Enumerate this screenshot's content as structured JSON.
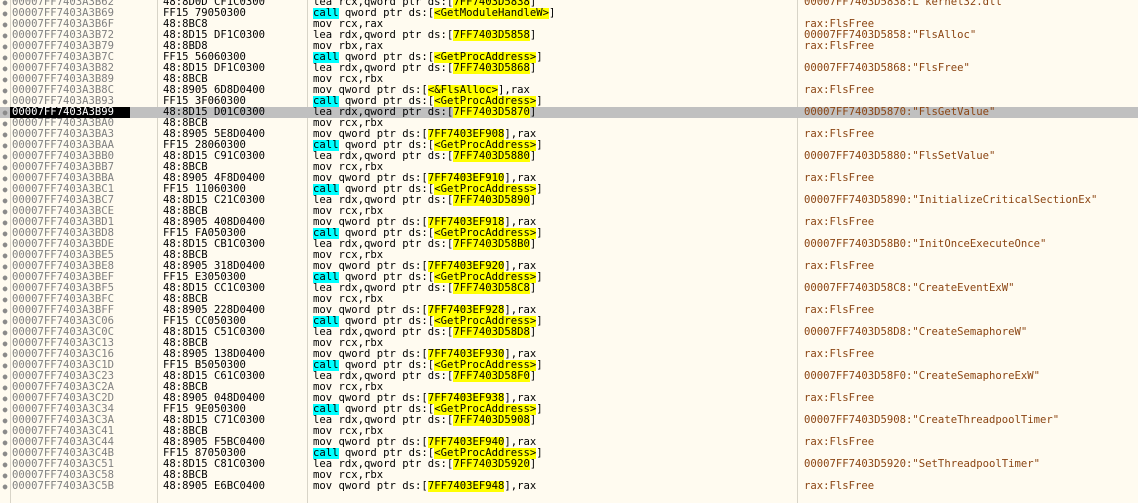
{
  "view": {
    "selected_address": "00007FF7403A3B99"
  },
  "rows": [
    {
      "addr": "00007FF7403A3B62",
      "bytes": "48:8D0D CF1C0300",
      "parts": [
        {
          "t": "mn",
          "v": "lea rcx,qword ptr ds:["
        },
        {
          "t": "mem",
          "v": "7FF7403D5838"
        },
        {
          "t": "mn",
          "v": "]"
        }
      ],
      "comment": "00007FF7403D5838:L\"kernel32.dll\""
    },
    {
      "addr": "00007FF7403A3B69",
      "bytes": "FF15 79050300",
      "parts": [
        {
          "t": "call",
          "v": "call"
        },
        {
          "t": "mn",
          "v": " qword ptr ds:["
        },
        {
          "t": "mem",
          "v": "<GetModuleHandleW>"
        },
        {
          "t": "mn",
          "v": "]"
        }
      ],
      "comment": ""
    },
    {
      "addr": "00007FF7403A3B6F",
      "bytes": "48:8BC8",
      "parts": [
        {
          "t": "mn",
          "v": "mov rcx,rax"
        }
      ],
      "comment": "rax:FlsFree"
    },
    {
      "addr": "00007FF7403A3B72",
      "bytes": "48:8D15 DF1C0300",
      "parts": [
        {
          "t": "mn",
          "v": "lea rdx,qword ptr ds:["
        },
        {
          "t": "mem",
          "v": "7FF7403D5858"
        },
        {
          "t": "mn",
          "v": "]"
        }
      ],
      "comment": "00007FF7403D5858:\"FlsAlloc\""
    },
    {
      "addr": "00007FF7403A3B79",
      "bytes": "48:8BD8",
      "parts": [
        {
          "t": "mn",
          "v": "mov rbx,rax"
        }
      ],
      "comment": "rax:FlsFree"
    },
    {
      "addr": "00007FF7403A3B7C",
      "bytes": "FF15 56060300",
      "parts": [
        {
          "t": "call",
          "v": "call"
        },
        {
          "t": "mn",
          "v": " qword ptr ds:["
        },
        {
          "t": "mem",
          "v": "<GetProcAddress>"
        },
        {
          "t": "mn",
          "v": "]"
        }
      ],
      "comment": ""
    },
    {
      "addr": "00007FF7403A3B82",
      "bytes": "48:8D15 DF1C0300",
      "parts": [
        {
          "t": "mn",
          "v": "lea rdx,qword ptr ds:["
        },
        {
          "t": "mem",
          "v": "7FF7403D5868"
        },
        {
          "t": "mn",
          "v": "]"
        }
      ],
      "comment": "00007FF7403D5868:\"FlsFree\""
    },
    {
      "addr": "00007FF7403A3B89",
      "bytes": "48:8BCB",
      "parts": [
        {
          "t": "mn",
          "v": "mov rcx,rbx"
        }
      ],
      "comment": ""
    },
    {
      "addr": "00007FF7403A3B8C",
      "bytes": "48:8905 6D8D0400",
      "parts": [
        {
          "t": "mn",
          "v": "mov qword ptr ds:["
        },
        {
          "t": "mem",
          "v": "<&FlsAlloc>"
        },
        {
          "t": "mn",
          "v": "],rax"
        }
      ],
      "comment": "rax:FlsFree"
    },
    {
      "addr": "00007FF7403A3B93",
      "bytes": "FF15 3F060300",
      "parts": [
        {
          "t": "call",
          "v": "call"
        },
        {
          "t": "mn",
          "v": " qword ptr ds:["
        },
        {
          "t": "mem",
          "v": "<GetProcAddress>"
        },
        {
          "t": "mn",
          "v": "]"
        }
      ],
      "comment": ""
    },
    {
      "addr": "00007FF7403A3B99",
      "bytes": "48:8D15 D01C0300",
      "parts": [
        {
          "t": "mn",
          "v": "lea rdx,qword ptr ds:["
        },
        {
          "t": "mem",
          "v": "7FF7403D5870"
        },
        {
          "t": "mn",
          "v": "]"
        }
      ],
      "comment": "00007FF7403D5870:\"FlsGetValue\""
    },
    {
      "addr": "00007FF7403A3BA0",
      "bytes": "48:8BCB",
      "parts": [
        {
          "t": "mn",
          "v": "mov rcx,rbx"
        }
      ],
      "comment": ""
    },
    {
      "addr": "00007FF7403A3BA3",
      "bytes": "48:8905 5E8D0400",
      "parts": [
        {
          "t": "mn",
          "v": "mov qword ptr ds:["
        },
        {
          "t": "mem",
          "v": "7FF7403EF908"
        },
        {
          "t": "mn",
          "v": "],rax"
        }
      ],
      "comment": "rax:FlsFree"
    },
    {
      "addr": "00007FF7403A3BAA",
      "bytes": "FF15 28060300",
      "parts": [
        {
          "t": "call",
          "v": "call"
        },
        {
          "t": "mn",
          "v": " qword ptr ds:["
        },
        {
          "t": "mem",
          "v": "<GetProcAddress>"
        },
        {
          "t": "mn",
          "v": "]"
        }
      ],
      "comment": ""
    },
    {
      "addr": "00007FF7403A3BB0",
      "bytes": "48:8D15 C91C0300",
      "parts": [
        {
          "t": "mn",
          "v": "lea rdx,qword ptr ds:["
        },
        {
          "t": "mem",
          "v": "7FF7403D5880"
        },
        {
          "t": "mn",
          "v": "]"
        }
      ],
      "comment": "00007FF7403D5880:\"FlsSetValue\""
    },
    {
      "addr": "00007FF7403A3BB7",
      "bytes": "48:8BCB",
      "parts": [
        {
          "t": "mn",
          "v": "mov rcx,rbx"
        }
      ],
      "comment": ""
    },
    {
      "addr": "00007FF7403A3BBA",
      "bytes": "48:8905 4F8D0400",
      "parts": [
        {
          "t": "mn",
          "v": "mov qword ptr ds:["
        },
        {
          "t": "mem",
          "v": "7FF7403EF910"
        },
        {
          "t": "mn",
          "v": "],rax"
        }
      ],
      "comment": "rax:FlsFree"
    },
    {
      "addr": "00007FF7403A3BC1",
      "bytes": "FF15 11060300",
      "parts": [
        {
          "t": "call",
          "v": "call"
        },
        {
          "t": "mn",
          "v": " qword ptr ds:["
        },
        {
          "t": "mem",
          "v": "<GetProcAddress>"
        },
        {
          "t": "mn",
          "v": "]"
        }
      ],
      "comment": ""
    },
    {
      "addr": "00007FF7403A3BC7",
      "bytes": "48:8D15 C21C0300",
      "parts": [
        {
          "t": "mn",
          "v": "lea rdx,qword ptr ds:["
        },
        {
          "t": "mem",
          "v": "7FF7403D5890"
        },
        {
          "t": "mn",
          "v": "]"
        }
      ],
      "comment": "00007FF7403D5890:\"InitializeCriticalSectionEx\""
    },
    {
      "addr": "00007FF7403A3BCE",
      "bytes": "48:8BCB",
      "parts": [
        {
          "t": "mn",
          "v": "mov rcx,rbx"
        }
      ],
      "comment": ""
    },
    {
      "addr": "00007FF7403A3BD1",
      "bytes": "48:8905 408D0400",
      "parts": [
        {
          "t": "mn",
          "v": "mov qword ptr ds:["
        },
        {
          "t": "mem",
          "v": "7FF7403EF918"
        },
        {
          "t": "mn",
          "v": "],rax"
        }
      ],
      "comment": "rax:FlsFree"
    },
    {
      "addr": "00007FF7403A3BD8",
      "bytes": "FF15 FA050300",
      "parts": [
        {
          "t": "call",
          "v": "call"
        },
        {
          "t": "mn",
          "v": " qword ptr ds:["
        },
        {
          "t": "mem",
          "v": "<GetProcAddress>"
        },
        {
          "t": "mn",
          "v": "]"
        }
      ],
      "comment": ""
    },
    {
      "addr": "00007FF7403A3BDE",
      "bytes": "48:8D15 CB1C0300",
      "parts": [
        {
          "t": "mn",
          "v": "lea rdx,qword ptr ds:["
        },
        {
          "t": "mem",
          "v": "7FF7403D58B0"
        },
        {
          "t": "mn",
          "v": "]"
        }
      ],
      "comment": "00007FF7403D58B0:\"InitOnceExecuteOnce\""
    },
    {
      "addr": "00007FF7403A3BE5",
      "bytes": "48:8BCB",
      "parts": [
        {
          "t": "mn",
          "v": "mov rcx,rbx"
        }
      ],
      "comment": ""
    },
    {
      "addr": "00007FF7403A3BE8",
      "bytes": "48:8905 318D0400",
      "parts": [
        {
          "t": "mn",
          "v": "mov qword ptr ds:["
        },
        {
          "t": "mem",
          "v": "7FF7403EF920"
        },
        {
          "t": "mn",
          "v": "],rax"
        }
      ],
      "comment": "rax:FlsFree"
    },
    {
      "addr": "00007FF7403A3BEF",
      "bytes": "FF15 E3050300",
      "parts": [
        {
          "t": "call",
          "v": "call"
        },
        {
          "t": "mn",
          "v": " qword ptr ds:["
        },
        {
          "t": "mem",
          "v": "<GetProcAddress>"
        },
        {
          "t": "mn",
          "v": "]"
        }
      ],
      "comment": ""
    },
    {
      "addr": "00007FF7403A3BF5",
      "bytes": "48:8D15 CC1C0300",
      "parts": [
        {
          "t": "mn",
          "v": "lea rdx,qword ptr ds:["
        },
        {
          "t": "mem",
          "v": "7FF7403D58C8"
        },
        {
          "t": "mn",
          "v": "]"
        }
      ],
      "comment": "00007FF7403D58C8:\"CreateEventExW\""
    },
    {
      "addr": "00007FF7403A3BFC",
      "bytes": "48:8BCB",
      "parts": [
        {
          "t": "mn",
          "v": "mov rcx,rbx"
        }
      ],
      "comment": ""
    },
    {
      "addr": "00007FF7403A3BFF",
      "bytes": "48:8905 228D0400",
      "parts": [
        {
          "t": "mn",
          "v": "mov qword ptr ds:["
        },
        {
          "t": "mem",
          "v": "7FF7403EF928"
        },
        {
          "t": "mn",
          "v": "],rax"
        }
      ],
      "comment": "rax:FlsFree"
    },
    {
      "addr": "00007FF7403A3C06",
      "bytes": "FF15 CC050300",
      "parts": [
        {
          "t": "call",
          "v": "call"
        },
        {
          "t": "mn",
          "v": " qword ptr ds:["
        },
        {
          "t": "mem",
          "v": "<GetProcAddress>"
        },
        {
          "t": "mn",
          "v": "]"
        }
      ],
      "comment": ""
    },
    {
      "addr": "00007FF7403A3C0C",
      "bytes": "48:8D15 C51C0300",
      "parts": [
        {
          "t": "mn",
          "v": "lea rdx,qword ptr ds:["
        },
        {
          "t": "mem",
          "v": "7FF7403D58D8"
        },
        {
          "t": "mn",
          "v": "]"
        }
      ],
      "comment": "00007FF7403D58D8:\"CreateSemaphoreW\""
    },
    {
      "addr": "00007FF7403A3C13",
      "bytes": "48:8BCB",
      "parts": [
        {
          "t": "mn",
          "v": "mov rcx,rbx"
        }
      ],
      "comment": ""
    },
    {
      "addr": "00007FF7403A3C16",
      "bytes": "48:8905 138D0400",
      "parts": [
        {
          "t": "mn",
          "v": "mov qword ptr ds:["
        },
        {
          "t": "mem",
          "v": "7FF7403EF930"
        },
        {
          "t": "mn",
          "v": "],rax"
        }
      ],
      "comment": "rax:FlsFree"
    },
    {
      "addr": "00007FF7403A3C1D",
      "bytes": "FF15 B5050300",
      "parts": [
        {
          "t": "call",
          "v": "call"
        },
        {
          "t": "mn",
          "v": " qword ptr ds:["
        },
        {
          "t": "mem",
          "v": "<GetProcAddress>"
        },
        {
          "t": "mn",
          "v": "]"
        }
      ],
      "comment": ""
    },
    {
      "addr": "00007FF7403A3C23",
      "bytes": "48:8D15 C61C0300",
      "parts": [
        {
          "t": "mn",
          "v": "lea rdx,qword ptr ds:["
        },
        {
          "t": "mem",
          "v": "7FF7403D58F0"
        },
        {
          "t": "mn",
          "v": "]"
        }
      ],
      "comment": "00007FF7403D58F0:\"CreateSemaphoreExW\""
    },
    {
      "addr": "00007FF7403A3C2A",
      "bytes": "48:8BCB",
      "parts": [
        {
          "t": "mn",
          "v": "mov rcx,rbx"
        }
      ],
      "comment": ""
    },
    {
      "addr": "00007FF7403A3C2D",
      "bytes": "48:8905 048D0400",
      "parts": [
        {
          "t": "mn",
          "v": "mov qword ptr ds:["
        },
        {
          "t": "mem",
          "v": "7FF7403EF938"
        },
        {
          "t": "mn",
          "v": "],rax"
        }
      ],
      "comment": "rax:FlsFree"
    },
    {
      "addr": "00007FF7403A3C34",
      "bytes": "FF15 9E050300",
      "parts": [
        {
          "t": "call",
          "v": "call"
        },
        {
          "t": "mn",
          "v": " qword ptr ds:["
        },
        {
          "t": "mem",
          "v": "<GetProcAddress>"
        },
        {
          "t": "mn",
          "v": "]"
        }
      ],
      "comment": ""
    },
    {
      "addr": "00007FF7403A3C3A",
      "bytes": "48:8D15 C71C0300",
      "parts": [
        {
          "t": "mn",
          "v": "lea rdx,qword ptr ds:["
        },
        {
          "t": "mem",
          "v": "7FF7403D5908"
        },
        {
          "t": "mn",
          "v": "]"
        }
      ],
      "comment": "00007FF7403D5908:\"CreateThreadpoolTimer\""
    },
    {
      "addr": "00007FF7403A3C41",
      "bytes": "48:8BCB",
      "parts": [
        {
          "t": "mn",
          "v": "mov rcx,rbx"
        }
      ],
      "comment": ""
    },
    {
      "addr": "00007FF7403A3C44",
      "bytes": "48:8905 F5BC0400",
      "parts": [
        {
          "t": "mn",
          "v": "mov qword ptr ds:["
        },
        {
          "t": "mem",
          "v": "7FF7403EF940"
        },
        {
          "t": "mn",
          "v": "],rax"
        }
      ],
      "comment": "rax:FlsFree"
    },
    {
      "addr": "00007FF7403A3C4B",
      "bytes": "FF15 87050300",
      "parts": [
        {
          "t": "call",
          "v": "call"
        },
        {
          "t": "mn",
          "v": " qword ptr ds:["
        },
        {
          "t": "mem",
          "v": "<GetProcAddress>"
        },
        {
          "t": "mn",
          "v": "]"
        }
      ],
      "comment": ""
    },
    {
      "addr": "00007FF7403A3C51",
      "bytes": "48:8D15 C81C0300",
      "parts": [
        {
          "t": "mn",
          "v": "lea rdx,qword ptr ds:["
        },
        {
          "t": "mem",
          "v": "7FF7403D5920"
        },
        {
          "t": "mn",
          "v": "]"
        }
      ],
      "comment": "00007FF7403D5920:\"SetThreadpoolTimer\""
    },
    {
      "addr": "00007FF7403A3C58",
      "bytes": "48:8BCB",
      "parts": [
        {
          "t": "mn",
          "v": "mov rcx,rbx"
        }
      ],
      "comment": ""
    },
    {
      "addr": "00007FF7403A3C5B",
      "bytes": "48:8905 E6BC0400",
      "parts": [
        {
          "t": "mn",
          "v": "mov qword ptr ds:["
        },
        {
          "t": "mem",
          "v": "7FF7403EF948"
        },
        {
          "t": "mn",
          "v": "],rax"
        }
      ],
      "comment": "rax:FlsFree"
    }
  ]
}
